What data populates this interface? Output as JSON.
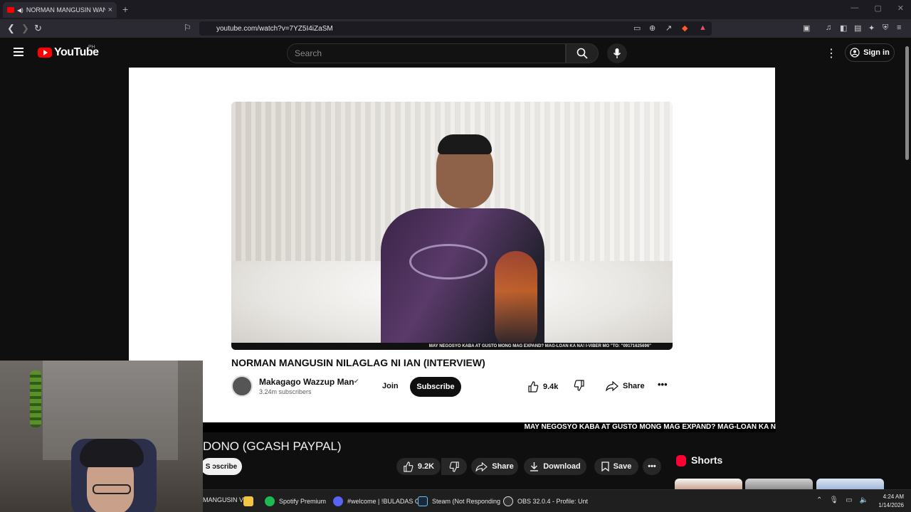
{
  "browser": {
    "tab_title": "NORMAN MANGUSIN WANT",
    "url": "youtube.com/watch?v=7YZ5I4iZaSM"
  },
  "header": {
    "logo_text": "YouTube",
    "country": "PH",
    "search_placeholder": "Search",
    "signin_label": "Sign in"
  },
  "embedded_video": {
    "ticker": "MAY NEGOSYO KABA AT GUSTO MONG MAG EXPAND? MAG-LOAN KA NA! I-VIBER MO \"TO: \"09171625696\"",
    "title": "NORMAN MANGUSIN NILAGLAG NI IAN (INTERVIEW)",
    "channel_name": "Makagago Wazzup Man",
    "subscribers": "3.24m subscribers",
    "join_label": "Join",
    "subscribe_label": "Subscribe",
    "likes": "9.4k",
    "share_label": "Share"
  },
  "outer_ticker": "MAY NEGOSYO KABA AT GUSTO MONG MAG EXPAND? MAG-LOAN KA N",
  "page_video": {
    "title_partial": "DONO (GCASH PAYPAL)",
    "subscribe_partial": "S  ɔscribe",
    "likes": "9.2K",
    "share_label": "Share",
    "download_label": "Download",
    "save_label": "Save"
  },
  "shorts_label": "Shorts",
  "taskbar": {
    "items": [
      {
        "label": "MANGUSIN V"
      },
      {
        "label": ""
      },
      {
        "label": "Spotify Premium"
      },
      {
        "label": "#welcome | !BULADAS C"
      },
      {
        "label": "Steam (Not Responding"
      },
      {
        "label": "OBS 32.0.4 - Profile: Unt"
      }
    ],
    "time": "4:24 AM",
    "date": "1/14/2026"
  },
  "colors": {
    "youtube_red": "#ff0000",
    "page_bg": "#0f0f0f",
    "pill_bg": "#272727"
  }
}
